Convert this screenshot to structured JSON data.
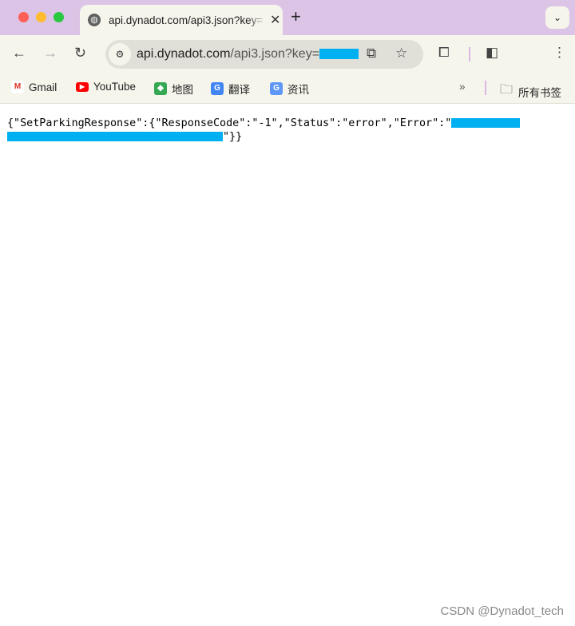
{
  "browser": {
    "tab": {
      "title": "api.dynadot.com/api3.json?key=",
      "favicon": "globe-icon"
    },
    "new_tab_label": "+",
    "address": {
      "host": "api.dynadot.com",
      "path": "/api3.json?key="
    },
    "bookmarks": [
      {
        "label": "Gmail",
        "icon": "gmail-icon"
      },
      {
        "label": "YouTube",
        "icon": "youtube-icon"
      },
      {
        "label": "地图",
        "icon": "maps-icon"
      },
      {
        "label": "翻译",
        "icon": "translate-icon"
      },
      {
        "label": "资讯",
        "icon": "news-icon"
      }
    ],
    "all_bookmarks_label": "所有书签",
    "overflow_label": "»"
  },
  "content": {
    "line1": "{\"SetParkingResponse\":{\"ResponseCode\":\"-1\",\"Status\":\"error\",\"Error\":\"",
    "line2_end": "\"}}",
    "redaction_color": "#00b0f0"
  },
  "watermark": "CSDN @Dynadot_tech"
}
